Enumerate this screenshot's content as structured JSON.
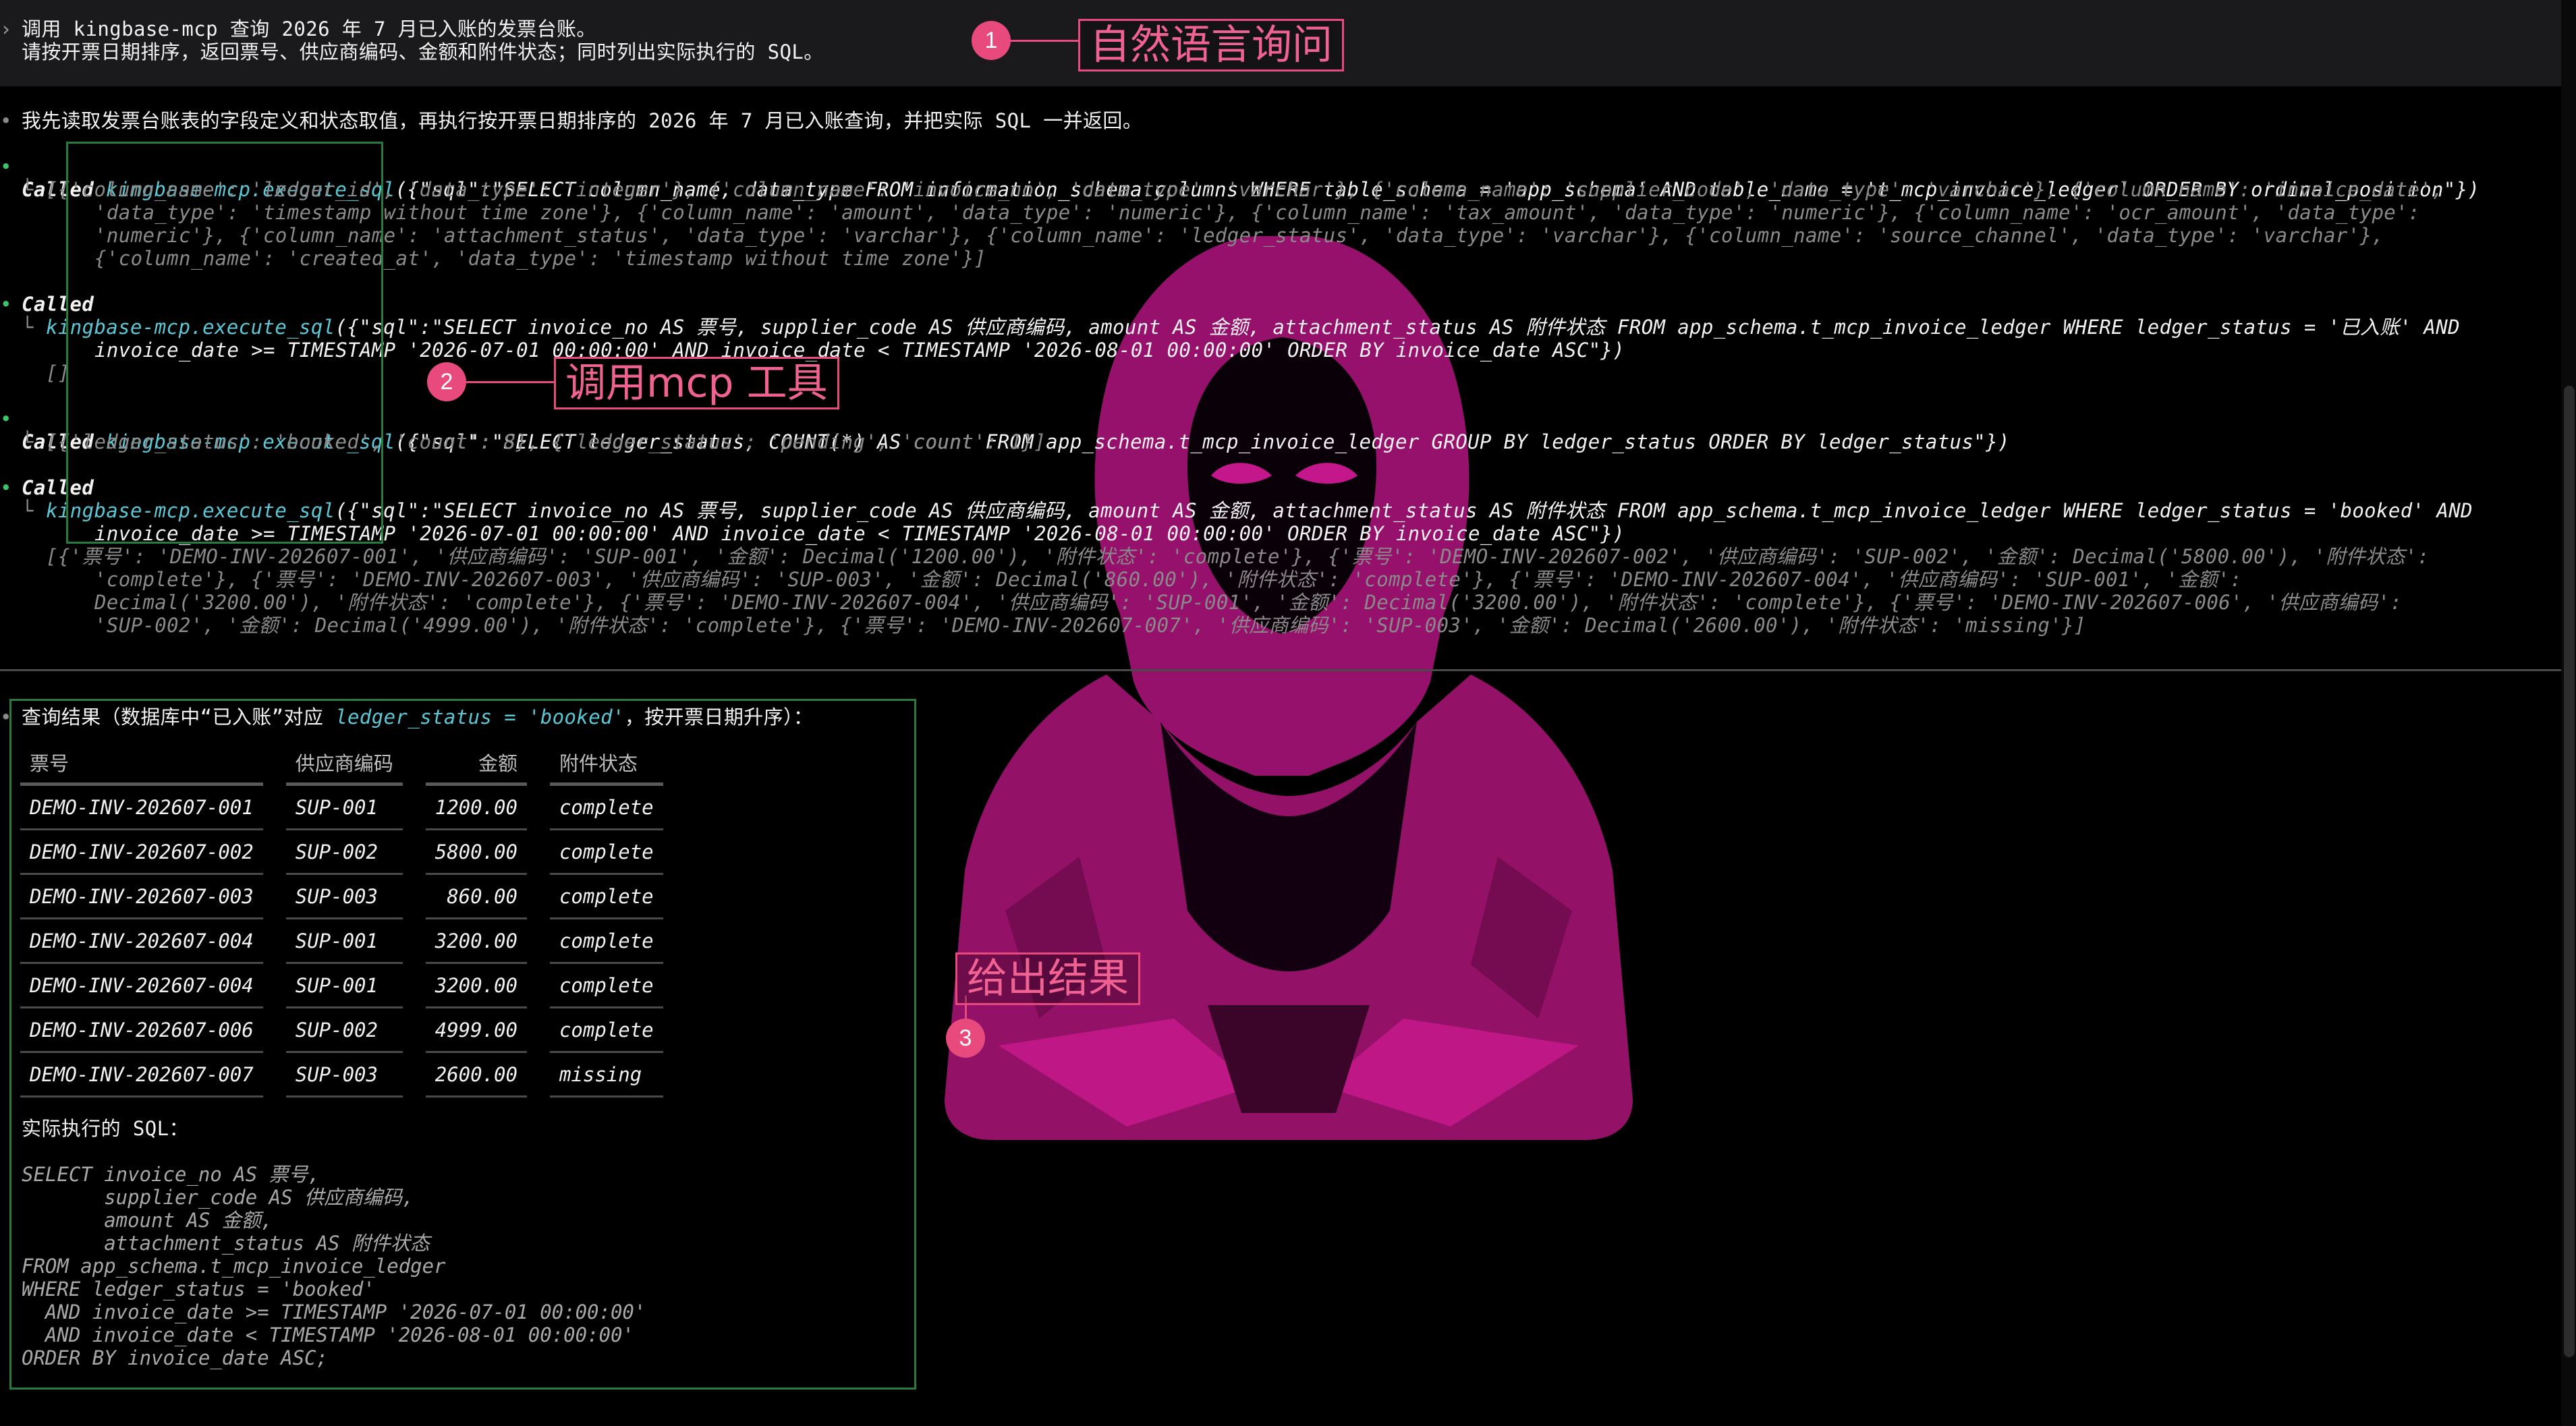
{
  "prompt": {
    "arrow": "›",
    "line1": "调用 kingbase-mcp 查询 2026 年 7 月已入账的发票台账。",
    "line2": "请按开票日期排序，返回票号、供应商编码、金额和附件状态；同时列出实际执行的 SQL。"
  },
  "intro": "我先读取发票台账表的字段定义和状态取值，再执行按开票日期排序的 2026 年 7 月已入账查询，并把实际 SQL 一并返回。",
  "bullet": "•",
  "tree": "└",
  "calls": [
    {
      "called": "Called",
      "tool": "kingbase-mcp.execute_sql",
      "args": "({\"sql\":\"SELECT column_name, data_type FROM information_schema.columns WHERE table_schema = 'app_schema' AND table_name = 't_mcp_invoice_ledger' ORDER BY ordinal_position\"})",
      "result": [
        "[{'column_name': 'ledger_id', 'data_type': 'integer'}, {'column_name': 'invoice_no', 'data_type': 'varchar'}, {'column_name': 'supplier_code', 'data_type': 'varchar'}, {'column_name': 'invoice_date',",
        "'data_type': 'timestamp without time zone'}, {'column_name': 'amount', 'data_type': 'numeric'}, {'column_name': 'tax_amount', 'data_type': 'numeric'}, {'column_name': 'ocr_amount', 'data_type':",
        "'numeric'}, {'column_name': 'attachment_status', 'data_type': 'varchar'}, {'column_name': 'ledger_status', 'data_type': 'varchar'}, {'column_name': 'source_channel', 'data_type': 'varchar'},",
        "{'column_name': 'created_at', 'data_type': 'timestamp without time zone'}]"
      ]
    },
    {
      "called": "Called",
      "tool": "kingbase-mcp.execute_sql",
      "args1": "({\"sql\":\"SELECT invoice_no AS 票号, supplier_code AS 供应商编码, amount AS 金额, attachment_status AS 附件状态 FROM app_schema.t_mcp_invoice_ledger WHERE ledger_status = '已入账' AND",
      "args2": "invoice_date >= TIMESTAMP '2026-07-01 00:00:00' AND invoice_date < TIMESTAMP '2026-08-01 00:00:00' ORDER BY invoice_date ASC\"})",
      "result": "[]"
    },
    {
      "called": "Called",
      "tool": "kingbase-mcp.execute_sql",
      "args": "({\"sql\":\"SELECT ledger_status, COUNT(*) AS count FROM app_schema.t_mcp_invoice_ledger GROUP BY ledger_status ORDER BY ledger_status\"})",
      "result": "[{'ledger_status': 'booked', 'count': 8}, {'ledger_status': 'pending', 'count': 1}]"
    },
    {
      "called": "Called",
      "tool": "kingbase-mcp.execute_sql",
      "args1": "({\"sql\":\"SELECT invoice_no AS 票号, supplier_code AS 供应商编码, amount AS 金额, attachment_status AS 附件状态 FROM app_schema.t_mcp_invoice_ledger WHERE ledger_status = 'booked' AND",
      "args2": "invoice_date >= TIMESTAMP '2026-07-01 00:00:00' AND invoice_date < TIMESTAMP '2026-08-01 00:00:00' ORDER BY invoice_date ASC\"})",
      "result": [
        "[{'票号': 'DEMO-INV-202607-001', '供应商编码': 'SUP-001', '金额': Decimal('1200.00'), '附件状态': 'complete'}, {'票号': 'DEMO-INV-202607-002', '供应商编码': 'SUP-002', '金额': Decimal('5800.00'), '附件状态':",
        "'complete'}, {'票号': 'DEMO-INV-202607-003', '供应商编码': 'SUP-003', '金额': Decimal('860.00'), '附件状态': 'complete'}, {'票号': 'DEMO-INV-202607-004', '供应商编码': 'SUP-001', '金额':",
        "Decimal('3200.00'), '附件状态': 'complete'}, {'票号': 'DEMO-INV-202607-004', '供应商编码': 'SUP-001', '金额': Decimal('3200.00'), '附件状态': 'complete'}, {'票号': 'DEMO-INV-202607-006', '供应商编码':",
        "'SUP-002', '金额': Decimal('4999.00'), '附件状态': 'complete'}, {'票号': 'DEMO-INV-202607-007', '供应商编码': 'SUP-003', '金额': Decimal('2600.00'), '附件状态': 'missing'}]"
      ]
    }
  ],
  "result_heading": {
    "prefix": "查询结果（数据库中“已入账”对应 ",
    "code": "ledger_status = 'booked'",
    "suffix": "，按开票日期升序）："
  },
  "table": {
    "headers": [
      "票号",
      "供应商编码",
      "金额",
      "附件状态"
    ],
    "rows": [
      [
        "DEMO-INV-202607-001",
        "SUP-001",
        "1200.00",
        "complete"
      ],
      [
        "DEMO-INV-202607-002",
        "SUP-002",
        "5800.00",
        "complete"
      ],
      [
        "DEMO-INV-202607-003",
        "SUP-003",
        "860.00",
        "complete"
      ],
      [
        "DEMO-INV-202607-004",
        "SUP-001",
        "3200.00",
        "complete"
      ],
      [
        "DEMO-INV-202607-004",
        "SUP-001",
        "3200.00",
        "complete"
      ],
      [
        "DEMO-INV-202607-006",
        "SUP-002",
        "4999.00",
        "complete"
      ],
      [
        "DEMO-INV-202607-007",
        "SUP-003",
        "2600.00",
        "missing"
      ]
    ]
  },
  "sql_heading": "实际执行的 SQL：",
  "sql_lines": [
    "SELECT invoice_no AS 票号,",
    "       supplier_code AS 供应商编码,",
    "       amount AS 金额,",
    "       attachment_status AS 附件状态",
    "FROM app_schema.t_mcp_invoice_ledger",
    "WHERE ledger_status = 'booked'",
    "  AND invoice_date >= TIMESTAMP '2026-07-01 00:00:00'",
    "  AND invoice_date < TIMESTAMP '2026-08-01 00:00:00'",
    "ORDER BY invoice_date ASC;"
  ],
  "annotations": [
    {
      "num": "1",
      "label": "自然语言询问"
    },
    {
      "num": "2",
      "label": "调用mcp 工具"
    },
    {
      "num": "3",
      "label": "给出结果"
    }
  ],
  "colors": {
    "background": "#000000",
    "prompt_bar": "#1a1a1c",
    "accent_pink": "#e94a7e",
    "tool_cyan": "#5cc8d6",
    "bullet_green": "#3cc46a",
    "box_green": "#2a7a3e",
    "art_magenta": "#b0147e"
  }
}
